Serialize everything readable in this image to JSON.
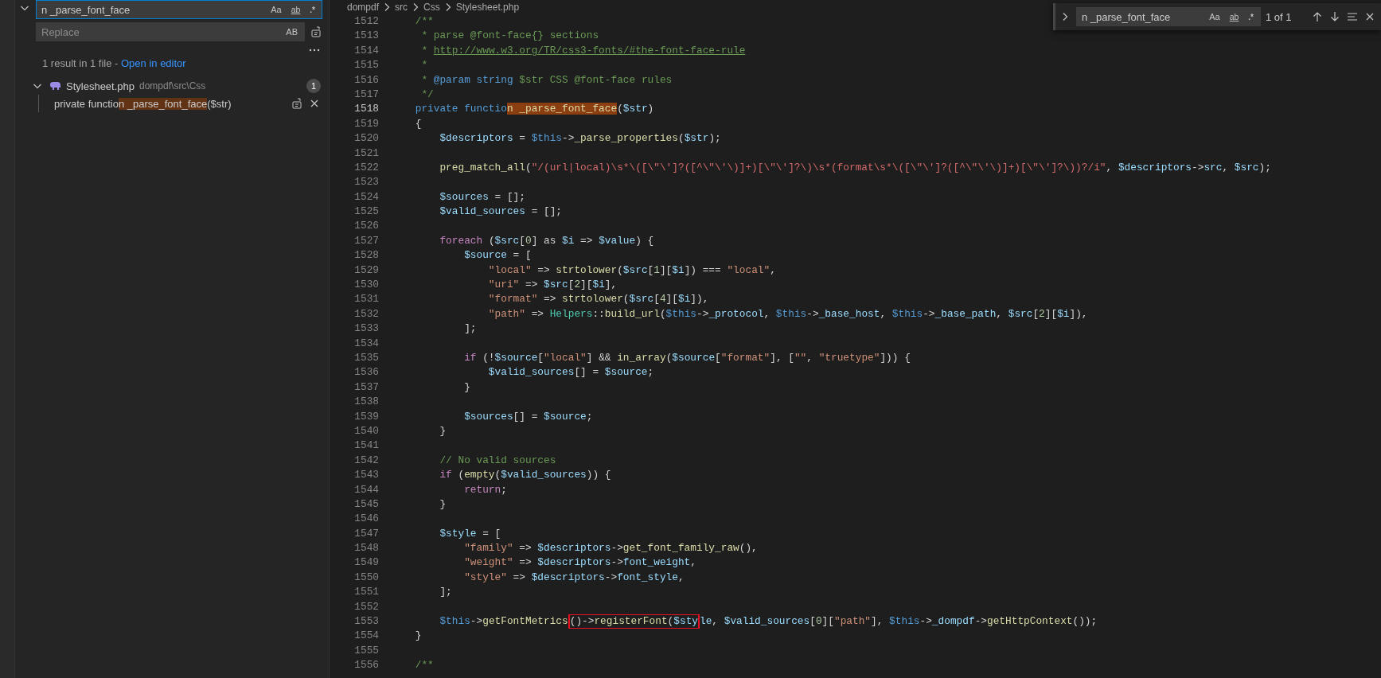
{
  "sidebar": {
    "search": {
      "value": "n _parse_font_face",
      "options": [
        {
          "kind": "case",
          "label": "Aa",
          "on": false
        },
        {
          "kind": "word",
          "label": "ab",
          "on": false
        },
        {
          "kind": "regex",
          "label": ".*",
          "on": false
        }
      ]
    },
    "replace": {
      "placeholder": "Replace",
      "options": [
        {
          "kind": "case",
          "label": "AB",
          "on": false
        }
      ]
    },
    "summary": {
      "text": "1 result in 1 file - ",
      "link": "Open in editor"
    },
    "results": [
      {
        "file": "Stylesheet.php",
        "path": "dompdf\\src\\Css",
        "count": "1",
        "expanded": true,
        "matches": [
          {
            "before": "private functio",
            "match": "n _parse_font_face",
            "after": "($str)"
          }
        ]
      }
    ]
  },
  "editor": {
    "breadcrumbs": [
      "dompdf",
      "src",
      "Css",
      "Stylesheet.php"
    ],
    "lines": [
      {
        "number": "1512",
        "active": false,
        "tokens": [
          {
            "kind": "comment",
            "text": "    /**"
          }
        ]
      },
      {
        "number": "1513",
        "active": false,
        "tokens": [
          {
            "kind": "comment",
            "text": "     * parse @font-face{} sections"
          }
        ]
      },
      {
        "number": "1514",
        "active": false,
        "tokens": [
          {
            "kind": "comment",
            "text": "     * "
          },
          {
            "kind": "link",
            "text": "http://www.w3.org/TR/css3-fonts/#the-font-face-rule"
          }
        ]
      },
      {
        "number": "1515",
        "active": false,
        "tokens": [
          {
            "kind": "comment",
            "text": "     *"
          }
        ]
      },
      {
        "number": "1516",
        "active": false,
        "tokens": [
          {
            "kind": "comment",
            "text": "     * "
          },
          {
            "kind": "doc",
            "text": "@param"
          },
          {
            "kind": "doc",
            "text": " string"
          },
          {
            "kind": "comment",
            "text": " $str CSS @font-face rules"
          }
        ]
      },
      {
        "number": "1517",
        "active": false,
        "tokens": [
          {
            "kind": "comment",
            "text": "     */"
          }
        ]
      },
      {
        "number": "1518",
        "active": true,
        "tokens": [
          {
            "kind": "kw",
            "text": "    private functio"
          },
          {
            "kind": "match",
            "text": "n _parse_font_face"
          },
          {
            "kind": "plain",
            "text": "("
          },
          {
            "kind": "var",
            "text": "$str"
          },
          {
            "kind": "plain",
            "text": ")"
          }
        ]
      },
      {
        "number": "1519",
        "active": false,
        "tokens": [
          {
            "kind": "plain",
            "text": "    {"
          }
        ]
      },
      {
        "number": "1520",
        "active": false,
        "tokens": [
          {
            "kind": "var",
            "text": "        $descriptors"
          },
          {
            "kind": "plain",
            "text": " = "
          },
          {
            "kind": "kw",
            "text": "$this"
          },
          {
            "kind": "plain",
            "text": "->"
          },
          {
            "kind": "fn",
            "text": "_parse_properties"
          },
          {
            "kind": "plain",
            "text": "("
          },
          {
            "kind": "var",
            "text": "$str"
          },
          {
            "kind": "plain",
            "text": ");"
          }
        ]
      },
      {
        "number": "1521",
        "active": false
      },
      {
        "number": "1522",
        "active": false,
        "tokens": [
          {
            "kind": "fn",
            "text": "        preg_match_all"
          },
          {
            "kind": "plain",
            "text": "("
          },
          {
            "kind": "regex",
            "text": "\"/(url|local)\\s*\\([\\\"\\']?([^\\\"\\'\\)]+)[\\\"\\']?\\)\\s*(format\\s*\\([\\\"\\']?([^\\\"\\'\\)]+)[\\\"\\']?\\))?/i\""
          },
          {
            "kind": "plain",
            "text": ", "
          },
          {
            "kind": "var",
            "text": "$descriptors"
          },
          {
            "kind": "plain",
            "text": "->"
          },
          {
            "kind": "var",
            "text": "src"
          },
          {
            "kind": "plain",
            "text": ", "
          },
          {
            "kind": "var",
            "text": "$src"
          },
          {
            "kind": "plain",
            "text": ");"
          }
        ]
      },
      {
        "number": "1523",
        "active": false
      },
      {
        "number": "1524",
        "active": false,
        "tokens": [
          {
            "kind": "var",
            "text": "        $sources"
          },
          {
            "kind": "plain",
            "text": " = [];"
          }
        ]
      },
      {
        "number": "1525",
        "active": false,
        "tokens": [
          {
            "kind": "var",
            "text": "        $valid_sources"
          },
          {
            "kind": "plain",
            "text": " = [];"
          }
        ]
      },
      {
        "number": "1526",
        "active": false
      },
      {
        "number": "1527",
        "active": false,
        "tokens": [
          {
            "kind": "ctrl",
            "text": "        foreach"
          },
          {
            "kind": "plain",
            "text": " ("
          },
          {
            "kind": "var",
            "text": "$src"
          },
          {
            "kind": "plain",
            "text": "["
          },
          {
            "kind": "num",
            "text": "0"
          },
          {
            "kind": "plain",
            "text": "] as "
          },
          {
            "kind": "var",
            "text": "$i"
          },
          {
            "kind": "plain",
            "text": " => "
          },
          {
            "kind": "var",
            "text": "$value"
          },
          {
            "kind": "plain",
            "text": ") {"
          }
        ]
      },
      {
        "number": "1528",
        "active": false,
        "tokens": [
          {
            "kind": "var",
            "text": "            $source"
          },
          {
            "kind": "plain",
            "text": " = ["
          }
        ]
      },
      {
        "number": "1529",
        "active": false,
        "tokens": [
          {
            "kind": "str",
            "text": "                \"local\""
          },
          {
            "kind": "plain",
            "text": " => "
          },
          {
            "kind": "fn",
            "text": "strtolower"
          },
          {
            "kind": "plain",
            "text": "("
          },
          {
            "kind": "var",
            "text": "$src"
          },
          {
            "kind": "plain",
            "text": "["
          },
          {
            "kind": "num",
            "text": "1"
          },
          {
            "kind": "plain",
            "text": "]["
          },
          {
            "kind": "var",
            "text": "$i"
          },
          {
            "kind": "plain",
            "text": "]) === "
          },
          {
            "kind": "str",
            "text": "\"local\""
          },
          {
            "kind": "plain",
            "text": ","
          }
        ]
      },
      {
        "number": "1530",
        "active": false,
        "tokens": [
          {
            "kind": "str",
            "text": "                \"uri\""
          },
          {
            "kind": "plain",
            "text": " => "
          },
          {
            "kind": "var",
            "text": "$src"
          },
          {
            "kind": "plain",
            "text": "["
          },
          {
            "kind": "num",
            "text": "2"
          },
          {
            "kind": "plain",
            "text": "]["
          },
          {
            "kind": "var",
            "text": "$i"
          },
          {
            "kind": "plain",
            "text": "],"
          }
        ]
      },
      {
        "number": "1531",
        "active": false,
        "tokens": [
          {
            "kind": "str",
            "text": "                \"format\""
          },
          {
            "kind": "plain",
            "text": " => "
          },
          {
            "kind": "fn",
            "text": "strtolower"
          },
          {
            "kind": "plain",
            "text": "("
          },
          {
            "kind": "var",
            "text": "$src"
          },
          {
            "kind": "plain",
            "text": "["
          },
          {
            "kind": "num",
            "text": "4"
          },
          {
            "kind": "plain",
            "text": "]["
          },
          {
            "kind": "var",
            "text": "$i"
          },
          {
            "kind": "plain",
            "text": "]),"
          }
        ]
      },
      {
        "number": "1532",
        "active": false,
        "tokens": [
          {
            "kind": "str",
            "text": "                \"path\""
          },
          {
            "kind": "plain",
            "text": " => "
          },
          {
            "kind": "cls",
            "text": "Helpers"
          },
          {
            "kind": "plain",
            "text": "::"
          },
          {
            "kind": "fn",
            "text": "build_url"
          },
          {
            "kind": "plain",
            "text": "("
          },
          {
            "kind": "kw",
            "text": "$this"
          },
          {
            "kind": "plain",
            "text": "->"
          },
          {
            "kind": "var",
            "text": "_protocol"
          },
          {
            "kind": "plain",
            "text": ", "
          },
          {
            "kind": "kw",
            "text": "$this"
          },
          {
            "kind": "plain",
            "text": "->"
          },
          {
            "kind": "var",
            "text": "_base_host"
          },
          {
            "kind": "plain",
            "text": ", "
          },
          {
            "kind": "kw",
            "text": "$this"
          },
          {
            "kind": "plain",
            "text": "->"
          },
          {
            "kind": "var",
            "text": "_base_path"
          },
          {
            "kind": "plain",
            "text": ", "
          },
          {
            "kind": "var",
            "text": "$src"
          },
          {
            "kind": "plain",
            "text": "["
          },
          {
            "kind": "num",
            "text": "2"
          },
          {
            "kind": "plain",
            "text": "]["
          },
          {
            "kind": "var",
            "text": "$i"
          },
          {
            "kind": "plain",
            "text": "]),"
          }
        ]
      },
      {
        "number": "1533",
        "active": false,
        "tokens": [
          {
            "kind": "plain",
            "text": "            ];"
          }
        ]
      },
      {
        "number": "1534",
        "active": false
      },
      {
        "number": "1535",
        "active": false,
        "tokens": [
          {
            "kind": "ctrl",
            "text": "            if"
          },
          {
            "kind": "plain",
            "text": " (!"
          },
          {
            "kind": "var",
            "text": "$source"
          },
          {
            "kind": "plain",
            "text": "["
          },
          {
            "kind": "str",
            "text": "\"local\""
          },
          {
            "kind": "plain",
            "text": "] && "
          },
          {
            "kind": "fn",
            "text": "in_array"
          },
          {
            "kind": "plain",
            "text": "("
          },
          {
            "kind": "var",
            "text": "$source"
          },
          {
            "kind": "plain",
            "text": "["
          },
          {
            "kind": "str",
            "text": "\"format\""
          },
          {
            "kind": "plain",
            "text": "], ["
          },
          {
            "kind": "str",
            "text": "\"\""
          },
          {
            "kind": "plain",
            "text": ", "
          },
          {
            "kind": "str",
            "text": "\"truetype\""
          },
          {
            "kind": "plain",
            "text": "])) {"
          }
        ]
      },
      {
        "number": "1536",
        "active": false,
        "tokens": [
          {
            "kind": "var",
            "text": "                $valid_sources"
          },
          {
            "kind": "plain",
            "text": "[] = "
          },
          {
            "kind": "var",
            "text": "$source"
          },
          {
            "kind": "plain",
            "text": ";"
          }
        ]
      },
      {
        "number": "1537",
        "active": false,
        "tokens": [
          {
            "kind": "plain",
            "text": "            }"
          }
        ]
      },
      {
        "number": "1538",
        "active": false
      },
      {
        "number": "1539",
        "active": false,
        "tokens": [
          {
            "kind": "var",
            "text": "            $sources"
          },
          {
            "kind": "plain",
            "text": "[] = "
          },
          {
            "kind": "var",
            "text": "$source"
          },
          {
            "kind": "plain",
            "text": ";"
          }
        ]
      },
      {
        "number": "1540",
        "active": false,
        "tokens": [
          {
            "kind": "plain",
            "text": "        }"
          }
        ]
      },
      {
        "number": "1541",
        "active": false
      },
      {
        "number": "1542",
        "active": false,
        "tokens": [
          {
            "kind": "comment",
            "text": "        // No valid sources"
          }
        ]
      },
      {
        "number": "1543",
        "active": false,
        "tokens": [
          {
            "kind": "ctrl",
            "text": "        if"
          },
          {
            "kind": "plain",
            "text": " ("
          },
          {
            "kind": "fn",
            "text": "empty"
          },
          {
            "kind": "plain",
            "text": "("
          },
          {
            "kind": "var",
            "text": "$valid_sources"
          },
          {
            "kind": "plain",
            "text": ")) {"
          }
        ]
      },
      {
        "number": "1544",
        "active": false,
        "tokens": [
          {
            "kind": "ctrl",
            "text": "            return"
          },
          {
            "kind": "plain",
            "text": ";"
          }
        ]
      },
      {
        "number": "1545",
        "active": false,
        "tokens": [
          {
            "kind": "plain",
            "text": "        }"
          }
        ]
      },
      {
        "number": "1546",
        "active": false
      },
      {
        "number": "1547",
        "active": false,
        "tokens": [
          {
            "kind": "var",
            "text": "        $style"
          },
          {
            "kind": "plain",
            "text": " = ["
          }
        ]
      },
      {
        "number": "1548",
        "active": false,
        "tokens": [
          {
            "kind": "str",
            "text": "            \"family\""
          },
          {
            "kind": "plain",
            "text": " => "
          },
          {
            "kind": "var",
            "text": "$descriptors"
          },
          {
            "kind": "plain",
            "text": "->"
          },
          {
            "kind": "fn",
            "text": "get_font_family_raw"
          },
          {
            "kind": "plain",
            "text": "(),"
          }
        ]
      },
      {
        "number": "1549",
        "active": false,
        "tokens": [
          {
            "kind": "str",
            "text": "            \"weight\""
          },
          {
            "kind": "plain",
            "text": " => "
          },
          {
            "kind": "var",
            "text": "$descriptors"
          },
          {
            "kind": "plain",
            "text": "->"
          },
          {
            "kind": "var",
            "text": "font_weight"
          },
          {
            "kind": "plain",
            "text": ","
          }
        ]
      },
      {
        "number": "1550",
        "active": false,
        "tokens": [
          {
            "kind": "str",
            "text": "            \"style\""
          },
          {
            "kind": "plain",
            "text": " => "
          },
          {
            "kind": "var",
            "text": "$descriptors"
          },
          {
            "kind": "plain",
            "text": "->"
          },
          {
            "kind": "var",
            "text": "font_style"
          },
          {
            "kind": "plain",
            "text": ","
          }
        ]
      },
      {
        "number": "1551",
        "active": false,
        "tokens": [
          {
            "kind": "plain",
            "text": "        ];"
          }
        ]
      },
      {
        "number": "1552",
        "active": false
      },
      {
        "number": "1553",
        "active": false,
        "tokens": [
          {
            "kind": "kw",
            "text": "        $this"
          },
          {
            "kind": "plain",
            "text": "->"
          },
          {
            "kind": "fn",
            "text": "getFontMetrics"
          },
          {
            "kind": "box",
            "tokens": [
              {
                "kind": "plain",
                "text": "()->"
              },
              {
                "kind": "fn",
                "text": "registerFont"
              },
              {
                "kind": "plain",
                "text": "("
              },
              {
                "kind": "var",
                "text": "$sty"
              }
            ]
          },
          {
            "kind": "var",
            "text": "le"
          },
          {
            "kind": "plain",
            "text": ", "
          },
          {
            "kind": "var",
            "text": "$valid_sources"
          },
          {
            "kind": "plain",
            "text": "["
          },
          {
            "kind": "num",
            "text": "0"
          },
          {
            "kind": "plain",
            "text": "]["
          },
          {
            "kind": "str",
            "text": "\"path\""
          },
          {
            "kind": "plain",
            "text": "], "
          },
          {
            "kind": "kw",
            "text": "$this"
          },
          {
            "kind": "plain",
            "text": "->"
          },
          {
            "kind": "var",
            "text": "_dompdf"
          },
          {
            "kind": "plain",
            "text": "->"
          },
          {
            "kind": "fn",
            "text": "getHttpContext"
          },
          {
            "kind": "plain",
            "text": "());"
          }
        ]
      },
      {
        "number": "1554",
        "active": false,
        "tokens": [
          {
            "kind": "plain",
            "text": "    }"
          }
        ]
      },
      {
        "number": "1555",
        "active": false
      },
      {
        "number": "1556",
        "active": false,
        "tokens": [
          {
            "kind": "comment",
            "text": "    /**"
          }
        ]
      }
    ]
  },
  "find_widget": {
    "value": "n _parse_font_face",
    "options": [
      {
        "kind": "case",
        "label": "Aa",
        "on": false
      },
      {
        "kind": "word",
        "label": "ab",
        "on": false
      },
      {
        "kind": "regex",
        "label": ".*",
        "on": false
      }
    ],
    "count": "1 of 1"
  }
}
